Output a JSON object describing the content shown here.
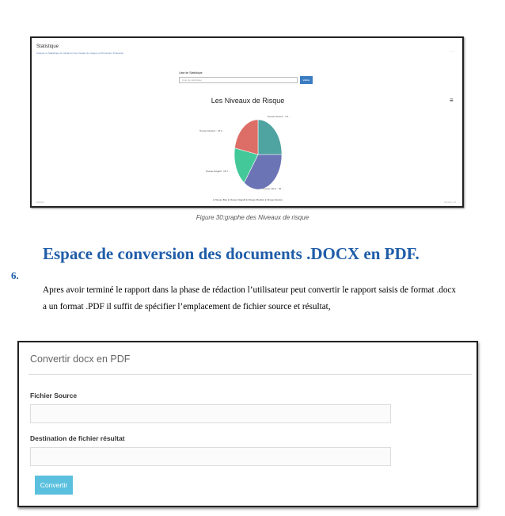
{
  "statistique": {
    "title": "Statistique",
    "subtitle": "Analyse et Statistique du travail sur les niveaux de risques et Prévention Protection",
    "corner_text": "— —",
    "list_label": "Liste de Statistique",
    "select_value": "Liste de statistique",
    "button_label": "Valider",
    "menu_icon": "≡",
    "footer_left": "Monitor",
    "footer_right": "Version 1.0"
  },
  "chart_data": {
    "type": "pie",
    "title": "Les Niveaux  de Risque",
    "slices": [
      {
        "name": "Niveau Sévère",
        "label": "Niveau Sévère : 2.5 ...",
        "value": 25,
        "color": "#4fa3a0"
      },
      {
        "name": "Niveau élevé",
        "label": "Niveau élevé : 35 ...",
        "value": 35,
        "color": "#6b74b4"
      },
      {
        "name": "Niveau Négatif",
        "label": "Niveau Négatif : 18.7 ...",
        "value": 18,
        "color": "#43c89a"
      },
      {
        "name": "Niveau Modéré",
        "label": "Niveau Modéré : 18.2 ...",
        "value": 22,
        "color": "#dd6e67"
      }
    ],
    "legend": "● Niveau Bas  ● Niveau Négatif  ● Niveau Modéré  ● Niveau Sévère"
  },
  "caption": "Figure 30:graphe des Niveaux de  risque",
  "section": {
    "number": "6.",
    "heading": "Espace de conversion des documents .DOCX en PDF.",
    "paragraph": "Apres avoir terminé le rapport dans la phase de rédaction l’utilisateur peut convertir le rapport saisis de format .docx a un format .PDF il suffit de spécifier l’emplacement de fichier source et résultat,"
  },
  "converter": {
    "title": "Convertir docx en PDF",
    "source_label": "Fichier Source",
    "source_value": "",
    "dest_label": "Destination de fichier résultat",
    "dest_value": "",
    "button_label": "Convertir"
  }
}
